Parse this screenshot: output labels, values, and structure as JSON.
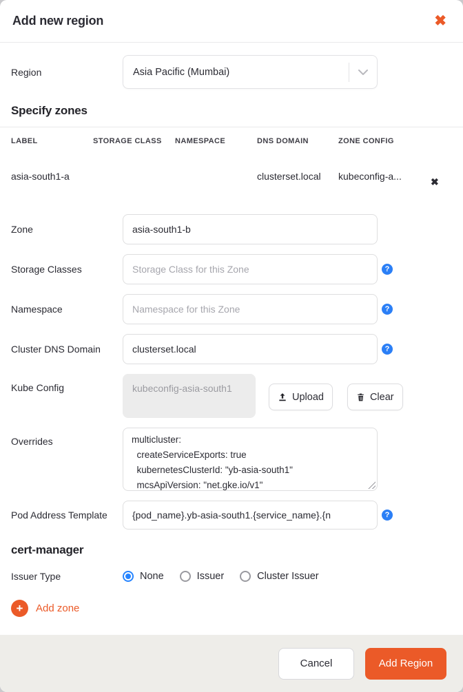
{
  "modal": {
    "title": "Add new region"
  },
  "region": {
    "label": "Region",
    "value": "Asia Pacific (Mumbai)"
  },
  "zones_section": {
    "heading": "Specify zones",
    "table": {
      "headers": [
        "LABEL",
        "STORAGE CLASS",
        "NAMESPACE",
        "DNS DOMAIN",
        "ZONE CONFIG"
      ],
      "row": {
        "label": "asia-south1-a",
        "storage_class": "",
        "namespace": "",
        "dns_domain": "clusterset.local",
        "zone_config": "kubeconfig-a..."
      }
    }
  },
  "form": {
    "zone": {
      "label": "Zone",
      "value": "asia-south1-b"
    },
    "storage_classes": {
      "label": "Storage Classes",
      "placeholder": "Storage Class for this Zone"
    },
    "namespace": {
      "label": "Namespace",
      "placeholder": "Namespace for this Zone"
    },
    "dns_domain": {
      "label": "Cluster DNS Domain",
      "value": "clusterset.local"
    },
    "kube_config": {
      "label": "Kube Config",
      "file_name": "kubeconfig-asia-south1",
      "upload_label": "Upload",
      "clear_label": "Clear"
    },
    "overrides": {
      "label": "Overrides",
      "value": "multicluster:\n  createServiceExports: true\n  kubernetesClusterId: \"yb-asia-south1\"\n  mcsApiVersion: \"net.gke.io/v1\""
    },
    "pod_address_template": {
      "label": "Pod Address Template",
      "value": "{pod_name}.yb-asia-south1.{service_name}.{n"
    }
  },
  "cert_manager": {
    "heading": "cert-manager",
    "issuer_type": {
      "label": "Issuer Type",
      "options": [
        {
          "label": "None",
          "selected": true
        },
        {
          "label": "Issuer",
          "selected": false
        },
        {
          "label": "Cluster Issuer",
          "selected": false
        }
      ]
    }
  },
  "add_zone": {
    "label": "Add zone",
    "plus": "+"
  },
  "footer": {
    "cancel_label": "Cancel",
    "submit_label": "Add Region"
  },
  "icons": {
    "close": "✖",
    "remove_row": "✖"
  },
  "colors": {
    "accent_orange": "#eb5a28",
    "help_blue": "#2b7ff6",
    "radio_blue": "#2684ff",
    "footer_bg": "#eeede9"
  }
}
